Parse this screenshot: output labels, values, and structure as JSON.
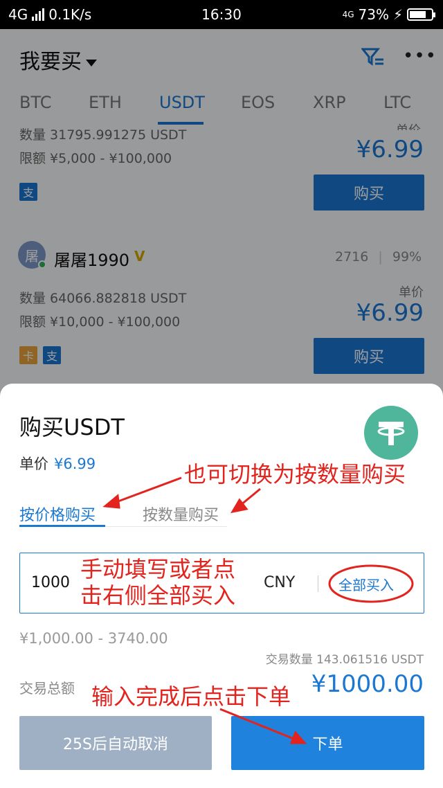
{
  "status_bar": {
    "network": "4G",
    "speed": "0.1K/s",
    "time": "16:30",
    "network_right": "4G",
    "battery": "73%",
    "charging_icon": "bolt-icon"
  },
  "header": {
    "title": "我要买",
    "filter_icon": "filter-icon",
    "more_icon": "more-icon"
  },
  "coin_tabs": [
    "BTC",
    "ETH",
    "USDT",
    "EOS",
    "XRP",
    "LTC"
  ],
  "active_tab": "USDT",
  "listings": [
    {
      "quantity": "数量 31795.991275 USDT",
      "limit": "限额 ¥5,000 - ¥100,000",
      "price_label": "单价",
      "price": "¥6.99",
      "pay_methods": [
        "支"
      ],
      "buy_label": "购买"
    },
    {
      "avatar_char": "屠",
      "name": "屠屠1990",
      "badge": "V",
      "orders": "2716",
      "rate": "99%",
      "quantity": "数量 64066.882818 USDT",
      "limit": "限额 ¥10,000 - ¥100,000",
      "price_label": "单价",
      "price": "¥6.99",
      "pay_methods": [
        "卡",
        "支"
      ],
      "buy_label": "购买"
    }
  ],
  "sheet": {
    "title": "购买USDT",
    "unit_price_label": "单价",
    "unit_price": "¥6.99",
    "tabs": [
      "按价格购买",
      "按数量购买"
    ],
    "input_value": "1000",
    "input_unit": "CNY",
    "buy_all": "全部买入",
    "range": "¥1,000.00 - 3740.00",
    "trade_qty": "交易数量 143.061516 USDT",
    "total_label": "交易总额",
    "total": "¥1000.00",
    "cancel_label": "25S后自动取消",
    "order_label": "下单"
  },
  "annotations": {
    "switch_hint": "也可切换为按数量购买",
    "fill_hint_line1": "手动填写或者点",
    "fill_hint_line2": "击右侧全部买入",
    "order_hint": "输入完成后点击下单",
    "color": "#e3231d"
  },
  "colors": {
    "accent": "#1a77d2",
    "tether": "#4fb69b",
    "disabled_button": "#9fb0c4"
  }
}
